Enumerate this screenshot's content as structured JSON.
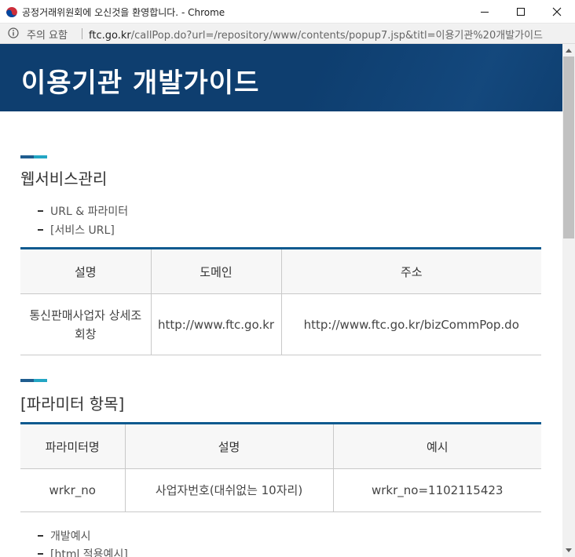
{
  "window": {
    "title": "공정거래위원회에 오신것을 환영합니다. - Chrome",
    "controls": {
      "minimize": "─",
      "maximize": "☐",
      "close": "✕"
    }
  },
  "address_bar": {
    "security_label": "주의 요함",
    "url_domain": "ftc.go.kr",
    "url_path": "/callPop.do?url=/repository/www/contents/popup7.jsp&titl=이용기관%20개발가이드"
  },
  "header": {
    "title": "이용기관 개발가이드"
  },
  "section1": {
    "title": "웹서비스관리",
    "bullets": [
      "URL & 파라미터",
      "[서비스 URL]"
    ],
    "table": {
      "headers": [
        "설명",
        "도메인",
        "주소"
      ],
      "rows": [
        [
          "통신판매사업자 상세조회창",
          "http://www.ftc.go.kr",
          "http://www.ftc.go.kr/bizCommPop.do"
        ]
      ]
    }
  },
  "section2": {
    "title": "[파라미터 항목]",
    "table": {
      "headers": [
        "파라미터명",
        "설명",
        "예시"
      ],
      "rows": [
        [
          "wrkr_no",
          "사업자번호(대쉬없는 10자리)",
          "wrkr_no=1102115423"
        ]
      ]
    },
    "bullets": [
      "개발예시",
      "[html 적용예시]"
    ]
  },
  "colors": {
    "header_bg": "#0e3e6f",
    "table_top_border": "#0e5a8f",
    "accent_dark": "#1f5d8f",
    "accent_light": "#23a6c4"
  }
}
